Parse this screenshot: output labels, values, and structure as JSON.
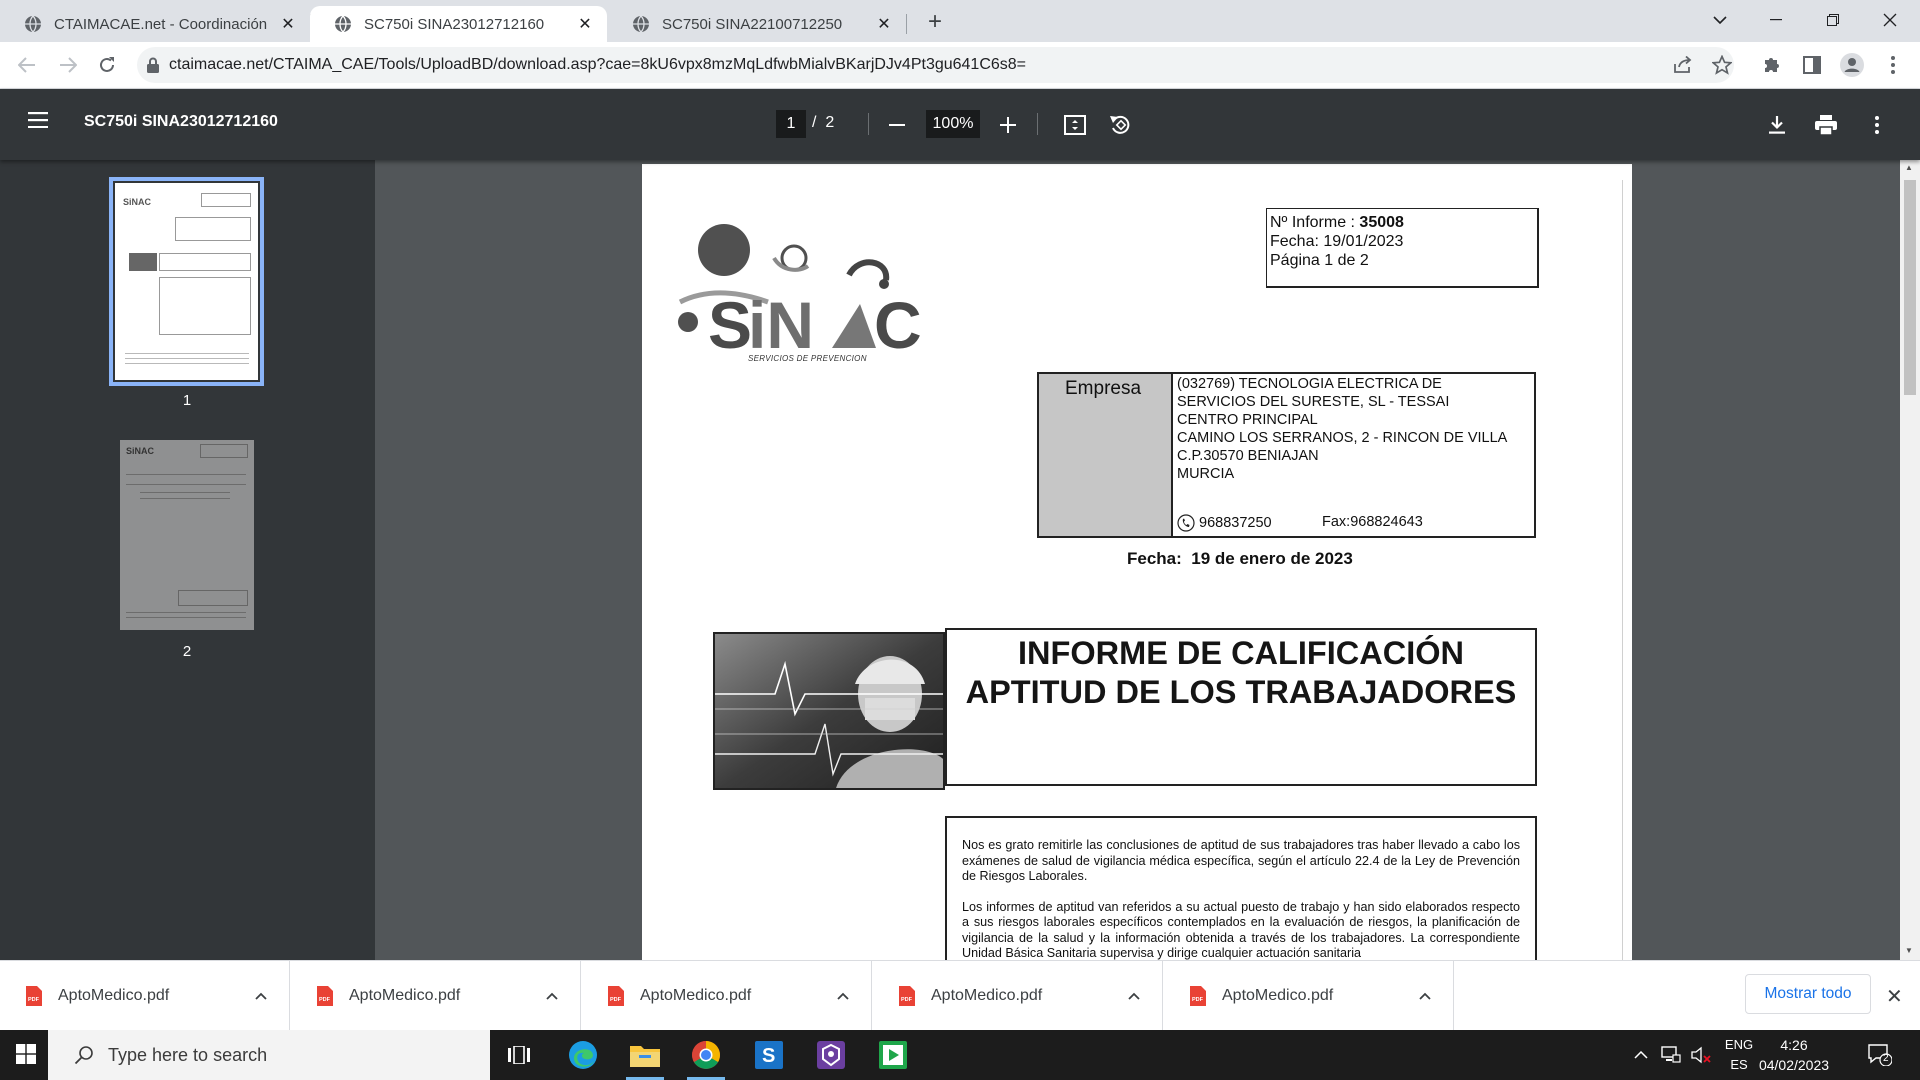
{
  "browser": {
    "tabs": [
      {
        "title": "CTAIMACAE.net - Coordinación de",
        "active": false
      },
      {
        "title": "SC750i SINA23012712160",
        "active": true
      },
      {
        "title": "SC750i SINA22100712250",
        "active": false
      }
    ],
    "url": "ctaimacae.net/CTAIMA_CAE/Tools/UploadBD/download.asp?cae=8kU6vpx8mzMqLdfwbMialvBKarjDJv4Pt3gu641C6s8="
  },
  "pdf_viewer": {
    "title": "SC750i SINA23012712160",
    "current_page": "1",
    "page_separator": "/",
    "total_pages": "2",
    "zoom": "100%",
    "thumbnails": [
      {
        "label": "1",
        "selected": true
      },
      {
        "label": "2",
        "selected": false
      }
    ]
  },
  "document": {
    "logo_text": "SINAC",
    "logo_subtitle": "SERVICIOS DE PREVENCION",
    "informe_label": "Nº Informe : ",
    "informe_number": "35008",
    "fecha_line": "Fecha: 19/01/2023",
    "pagina_line": "Página 1 de 2",
    "empresa_label": "Empresa",
    "empresa_lines": [
      "(032769) TECNOLOGIA ELECTRICA DE",
      "SERVICIOS DEL SURESTE, SL - TESSAI",
      "CENTRO PRINCIPAL",
      "CAMINO LOS SERRANOS, 2 - RINCON DE VILLA",
      "C.P.30570 BENIAJAN",
      "MURCIA"
    ],
    "phone": "968837250",
    "fax": "Fax:968824643",
    "fecha_label": "Fecha:",
    "fecha_value": "19 de enero de 2023",
    "title_line1": "INFORME DE CALIFICACIÓN",
    "title_line2": "APTITUD DE LOS TRABAJADORES",
    "paragraph1": "Nos es grato remitirle las conclusiones de aptitud de sus trabajadores tras haber llevado a cabo los exámenes de salud de vigilancia médica específica, según el artículo 22.4 de la Ley de Prevención de Riesgos Laborales.",
    "paragraph2": "Los informes de aptitud van referidos a su actual puesto de trabajo y han sido elaborados respecto a sus riesgos laborales específicos contemplados en la evaluación de riesgos, la planificación de vigilancia de la salud y la información obtenida a través de los trabajadores. La correspondiente Unidad Básica Sanitaria supervisa y dirige cualquier actuación sanitaria"
  },
  "downloads": {
    "items": [
      "AptoMedico.pdf",
      "AptoMedico.pdf",
      "AptoMedico.pdf",
      "AptoMedico.pdf",
      "AptoMedico.pdf"
    ],
    "show_all": "Mostrar todo"
  },
  "taskbar": {
    "search_placeholder": "Type here to search",
    "lang_top": "ENG",
    "lang_bottom": "ES",
    "time": "4:26",
    "date": "04/02/2023",
    "notification_count": "2"
  },
  "colors": {
    "pdf_toolbar": "#323639",
    "pdf_background": "#525659",
    "accent": "#1a73e8",
    "thumb_selected": "#8ab4f8"
  }
}
